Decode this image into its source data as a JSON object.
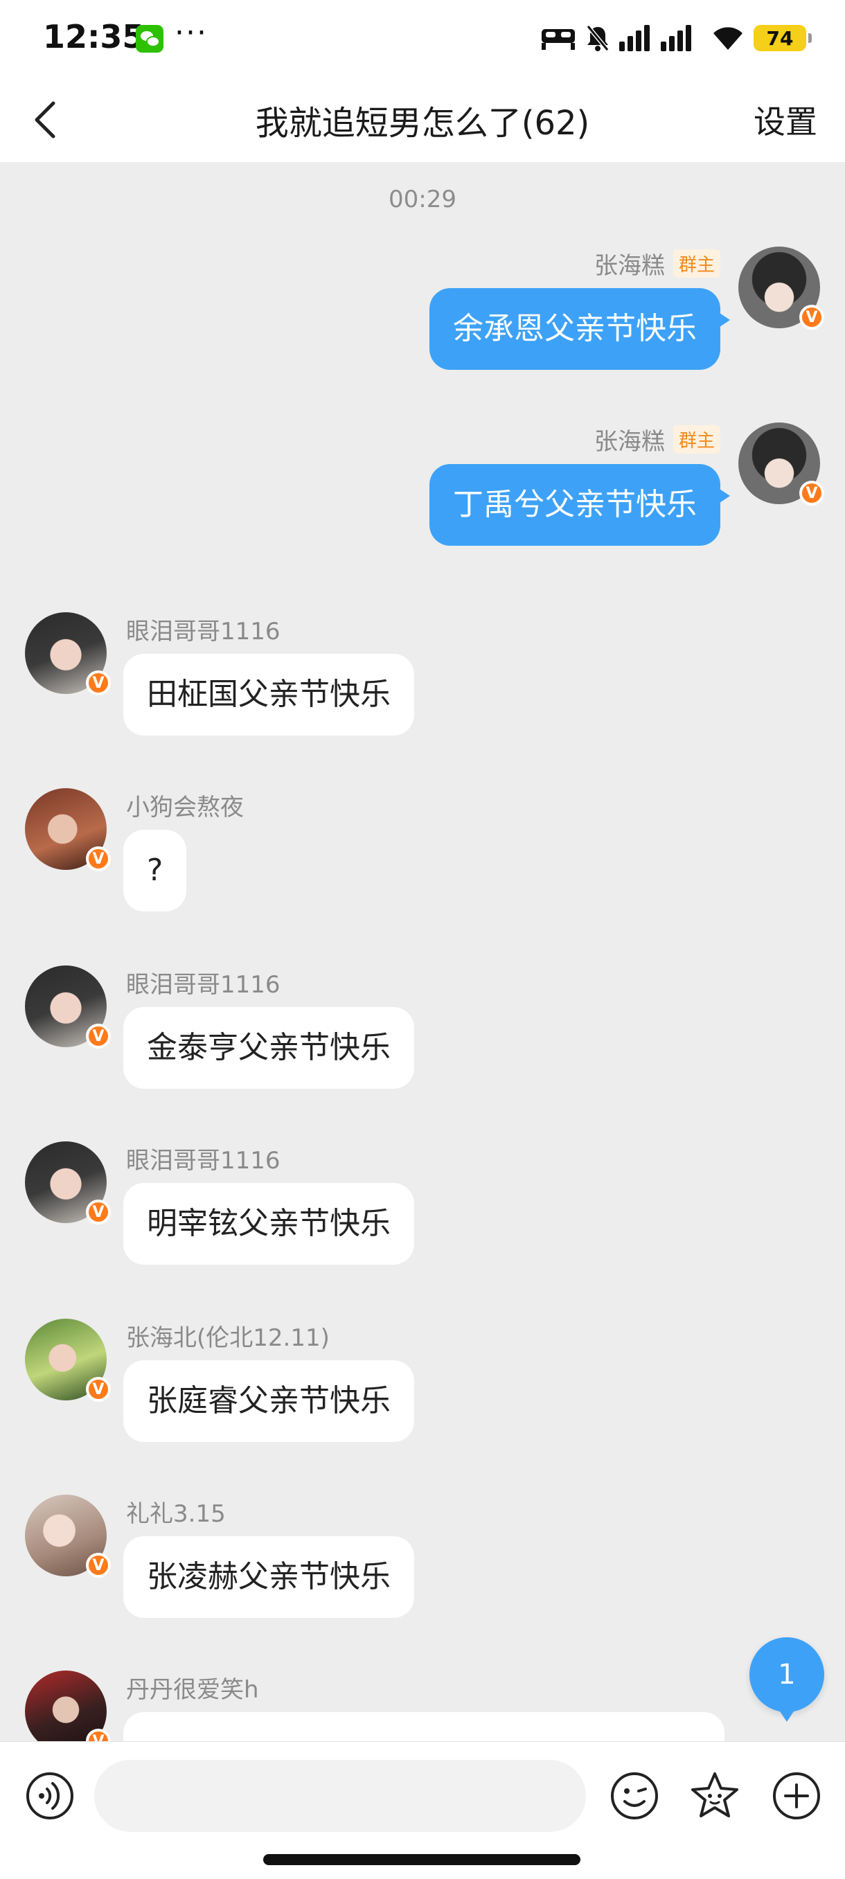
{
  "status_bar": {
    "time": "12:35",
    "more": "···",
    "battery": "74"
  },
  "header": {
    "title": "我就追短男怎么了(62)",
    "settings_label": "设置"
  },
  "chat": {
    "timestamp": "00:29",
    "owner_tag": "群主",
    "verified_mark": "V",
    "messages": [
      {
        "sender": "张海糕",
        "text": "余承恩父亲节快乐"
      },
      {
        "sender": "张海糕",
        "text": "丁禹兮父亲节快乐"
      },
      {
        "sender": "眼泪哥哥1116",
        "text": "田柾国父亲节快乐"
      },
      {
        "sender": "小狗会熬夜",
        "text": "?"
      },
      {
        "sender": "眼泪哥哥1116",
        "text": "金泰亨父亲节快乐"
      },
      {
        "sender": "眼泪哥哥1116",
        "text": "明宰铉父亲节快乐"
      },
      {
        "sender": "张海北(伦北12.11)",
        "text": "张庭睿父亲节快乐"
      },
      {
        "sender": "礼礼3.15",
        "text": "张凌赫父亲节快乐"
      },
      {
        "sender": "丹丹很爱笑h",
        "text": ""
      }
    ],
    "unread_count": "1"
  },
  "input_bar": {
    "placeholder": ""
  },
  "colors": {
    "outgoing_bubble": "#3da2f7",
    "incoming_bubble": "#ffffff",
    "chat_background": "#ededed",
    "verified_badge": "#ff7a1a",
    "owner_tag_text": "#f08a1c"
  }
}
